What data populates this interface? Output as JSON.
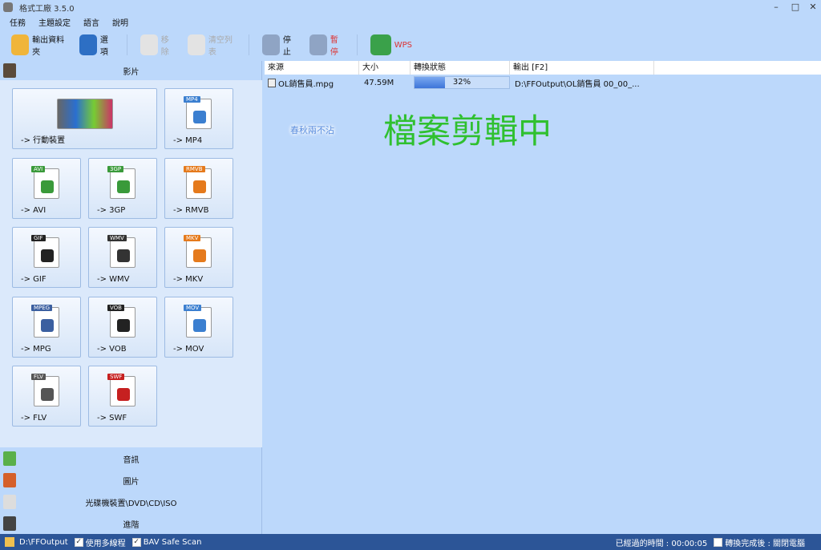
{
  "window": {
    "title": "格式工廠 3.5.0",
    "minimize": "–",
    "maximize": "□",
    "close": "✕"
  },
  "menu": [
    "任務",
    "主題設定",
    "語言",
    "說明"
  ],
  "toolbar": [
    {
      "label": "輸出資料夾",
      "icon": "output-folder-icon",
      "state": "enabled",
      "color": "#f0b53a"
    },
    {
      "label": "選項",
      "icon": "options-gear-icon",
      "state": "enabled",
      "color": "#2d6fc4"
    },
    {
      "label": "移除",
      "icon": "remove-icon",
      "state": "disabled",
      "color": "#e3e3e3"
    },
    {
      "label": "清空列表",
      "icon": "clear-list-icon",
      "state": "disabled",
      "color": "#e3e3e3"
    },
    {
      "label": "停止",
      "icon": "stop-icon",
      "state": "enabled",
      "color": "#8fa4c4"
    },
    {
      "label": "暫停",
      "icon": "pause-icon",
      "state": "red",
      "color": "#8fa4c4"
    },
    {
      "label": "WPS",
      "icon": "wps-icon",
      "state": "red",
      "color": "#3aa14a"
    }
  ],
  "left": {
    "video_header": "影片",
    "tiles": [
      {
        "label": "-> 行動裝置",
        "tag": "",
        "color": "#555"
      },
      {
        "label": "-> MP4",
        "tag": "MP4",
        "color": "#3b7fd0"
      },
      {
        "label": "-> AVI",
        "tag": "AVI",
        "color": "#3a9a3a"
      },
      {
        "label": "-> 3GP",
        "tag": "3GP",
        "color": "#3a9a3a"
      },
      {
        "label": "-> RMVB",
        "tag": "RMVB",
        "color": "#e57a1c"
      },
      {
        "label": "-> GIF",
        "tag": "GIF",
        "color": "#222"
      },
      {
        "label": "-> WMV",
        "tag": "WMV",
        "color": "#333"
      },
      {
        "label": "-> MKV",
        "tag": "MKV",
        "color": "#e57a1c"
      },
      {
        "label": "-> MPG",
        "tag": "MPEG",
        "color": "#3b5fa0"
      },
      {
        "label": "-> VOB",
        "tag": "VOB",
        "color": "#222"
      },
      {
        "label": "-> MOV",
        "tag": "MOV",
        "color": "#3b7fd0"
      },
      {
        "label": "-> FLV",
        "tag": "FLV",
        "color": "#555"
      },
      {
        "label": "-> SWF",
        "tag": "SWF",
        "color": "#c62020"
      }
    ],
    "categories": [
      {
        "label": "音訊",
        "icon": "music-icon",
        "color": "#5ab04a"
      },
      {
        "label": "圖片",
        "icon": "picture-icon",
        "color": "#d5602a"
      },
      {
        "label": "光碟機裝置\\DVD\\CD\\ISO",
        "icon": "disc-drive-icon",
        "color": "#ddd"
      },
      {
        "label": "進階",
        "icon": "advanced-icon",
        "color": "#444"
      }
    ]
  },
  "table": {
    "headers": [
      "來源",
      "大小",
      "轉換狀態",
      "輸出 [F2]"
    ],
    "rows": [
      {
        "source": "OL銷售員.mpg",
        "size": "47.59M",
        "progress_percent": 32,
        "progress_label": "32%",
        "output": "D:\\FFOutput\\OL銷售員 00_00_..."
      }
    ]
  },
  "overlay": {
    "watermark": "春秋兩不沾",
    "caption": "檔案剪輯中"
  },
  "status": {
    "folder": "D:\\FFOutput",
    "multithread": "使用多線程",
    "multithread_checked": true,
    "bav": "BAV Safe Scan",
    "bav_checked": true,
    "elapsed": "已經過的時間 : 00:00:05",
    "after": "轉換完成後 : 關閉電腦",
    "after_checked": false
  }
}
